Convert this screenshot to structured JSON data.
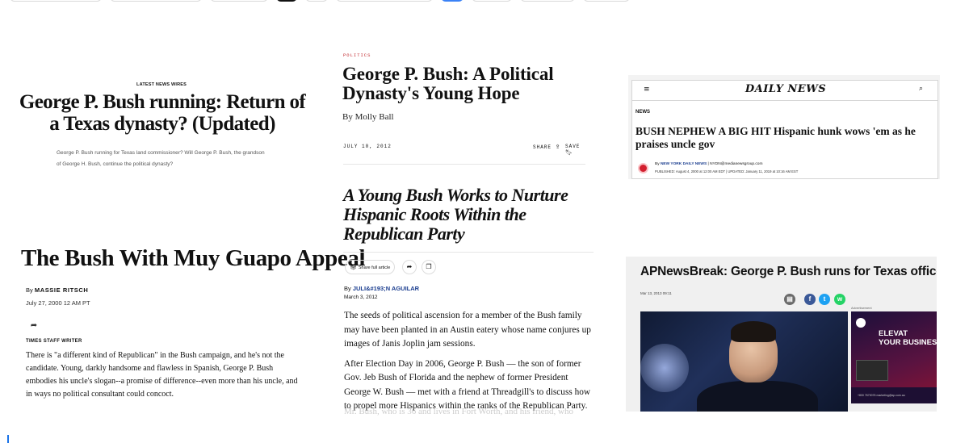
{
  "col1": {
    "kicker": "LATEST NEWS WIRES",
    "headline": "George P. Bush running: Return of a Texas dynasty? (Updated)",
    "deck": "George P. Bush running for Texas land commissioner? Will George P. Bush, the grandson of George H. Bush, continue the political dynasty?",
    "headline2": "The Bush With Muy Guapo Appeal",
    "by_prefix": "By ",
    "author": "MASSIE RITSCH",
    "date": "July 27, 2000 12 AM PT",
    "role": "TIMES STAFF WRITER",
    "body": "There is \"a different kind of Republican\" in the Bush campaign, and he's not the candidate. Young, darkly handsome and flawless in Spanish, George P. Bush embodies his uncle's slogan--a promise of difference--even more than his uncle, and in ways no political consultant could concoct."
  },
  "col2": {
    "section": "POLITICS",
    "headline": "George P. Bush: A Political Dynasty's Young Hope",
    "byline": "By Molly Ball",
    "date": "JULY 10, 2012",
    "share_label": "SHARE",
    "save_label": "SAVE",
    "headline2": "A Young Bush Works to Nurture Hispanic Roots Within the Republican Party",
    "share_full": "Share full article",
    "by_prefix": "By ",
    "author": "JULI&#193;N AGUILAR",
    "date2": "March 3, 2012",
    "para1": "The seeds of political ascension for a member of the Bush family may have been planted in an Austin eatery whose name conjures up images of Janis Joplin jam sessions.",
    "para2": "After Election Day in 2006, George P. Bush — the son of former Gov. Jeb Bush of Florida and the nephew of former President George W. Bush — met with a friend at Threadgill's to discuss how to propel more Hispanics within the ranks of the Republican Party.",
    "para3_fade": "Mr. Bush, who is 36 and lives in Fort Worth, and his friend, who"
  },
  "dailynews": {
    "logo": "DAILY NEWS",
    "kicker": "NEWS",
    "headline": "BUSH NEPHEW A BIG HIT Hispanic hunk wows 'em as he praises uncle gov",
    "by_prefix": "By ",
    "outlet": "NEW YORK DAILY NEWS",
    "contact": " | NYDN@medianewsgroup.com",
    "published": "PUBLISHED: August 4, 2000 at 12:00 AM EDT | UPDATED: January 11, 2019 at 10:16 AM EST"
  },
  "ap": {
    "headline": "APNewsBreak: George P. Bush runs for Texas office",
    "date": "Mar 13, 2013 09:11",
    "ad_label": "Advertisement",
    "ad_title": "ELEVAT\nYOUR BUSINES",
    "ad_foot": "+800 7670076   marketing@ap.com.au"
  },
  "colors": {
    "section_red": "#c1272d",
    "link_blue": "#1a3d8f",
    "facebook": "#3b5998",
    "twitter": "#1da1f2",
    "whatsapp": "#25d366"
  },
  "icons": [
    "share-icon",
    "bookmark-icon",
    "menu-icon",
    "search-icon",
    "print-icon",
    "facebook-icon",
    "twitter-icon",
    "whatsapp-icon"
  ]
}
